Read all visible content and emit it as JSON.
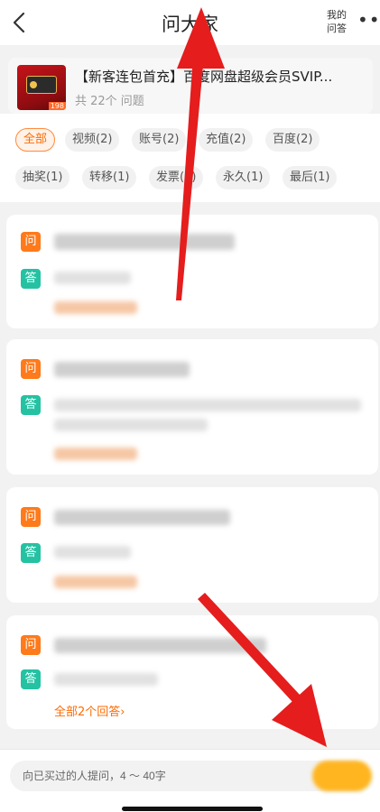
{
  "header": {
    "title": "问大家",
    "my_answers_line1": "我的",
    "my_answers_line2": "问答",
    "more": "•••"
  },
  "product": {
    "title": "【新客连包首充】百度网盘超级会员SVIP...",
    "question_count": "共 22个 问题",
    "thumb_price": "198"
  },
  "tags": [
    {
      "label": "全部",
      "active": true
    },
    {
      "label": "视频(2)"
    },
    {
      "label": "账号(2)"
    },
    {
      "label": "充值(2)"
    },
    {
      "label": "百度(2)"
    },
    {
      "label": "抽奖(1)"
    },
    {
      "label": "转移(1)"
    },
    {
      "label": "发票(1)"
    },
    {
      "label": "永久(1)"
    },
    {
      "label": "最后(1)"
    }
  ],
  "qa": {
    "question_badge": "问",
    "answer_badge": "答",
    "all_answers_label": "全部2个回答",
    "all_answers_chevron": "›"
  },
  "bottom": {
    "placeholder": "向已买过的人提问，4 ～ 40字"
  },
  "colors": {
    "accent": "#ff6a00",
    "question_badge": "#ff7a1a",
    "answer_badge": "#24c2a2",
    "annotation_arrow": "#e51d1d"
  }
}
